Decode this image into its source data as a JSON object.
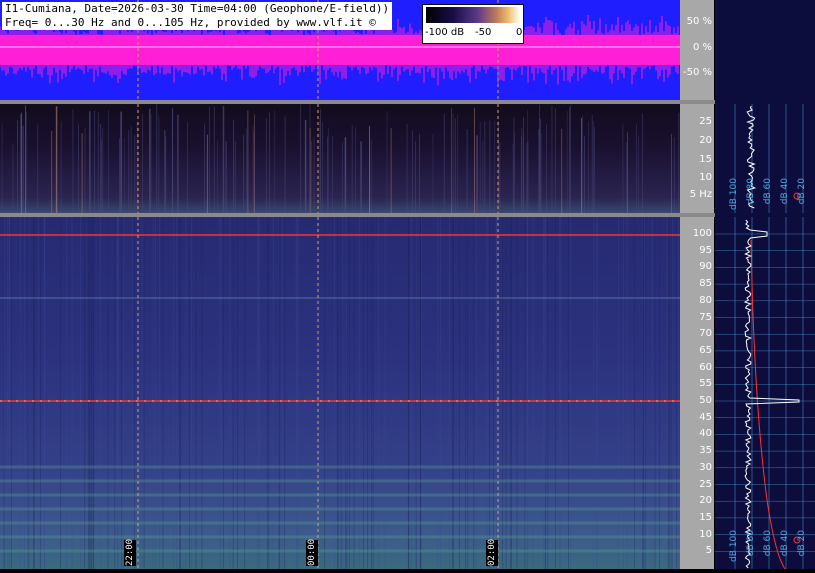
{
  "header": {
    "line1": "I1-Cumiana, Date=2026-03-30 Time=04:00 (Geophone/E-field))",
    "line2": "Freq= 0...30 Hz and 0...105 Hz, provided by www.vlf.it ©"
  },
  "colorbar": {
    "min_label": "-100 dB",
    "mid_label": "-50",
    "max_label": "0"
  },
  "waveform_axis": [
    "50 %",
    "0 %",
    "-50 %"
  ],
  "low_freq_axis": [
    "25",
    "20",
    "15",
    "10",
    "5 Hz"
  ],
  "main_freq_axis": [
    "100",
    "95",
    "90",
    "85",
    "80",
    "75",
    "70",
    "65",
    "60",
    "55",
    "50",
    "45",
    "40",
    "35",
    "30",
    "25",
    "20",
    "15",
    "10",
    "5"
  ],
  "time_labels": [
    "22:00",
    "00:00",
    "02:00"
  ],
  "profile_top_labels": [
    "dB 100",
    "dB 80",
    "dB 60",
    "dB 40",
    "dB 20"
  ],
  "profile_bottom_labels": [
    "dB 100",
    "dB 80",
    "dB 60",
    "dB 40",
    "dB 20"
  ],
  "colors": {
    "waveform_bg": "#1e1eff",
    "waveform_trace": "#ff1fd6",
    "marker_line": "#ff3030",
    "axis_bg": "#a8a8a8"
  }
}
